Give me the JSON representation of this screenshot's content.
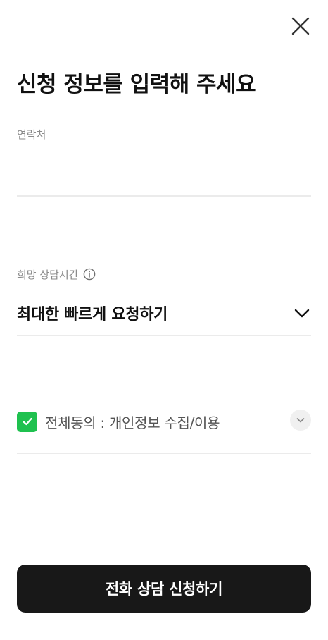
{
  "header": {
    "close_icon": "close-icon",
    "title": "신청 정보를 입력해 주세요"
  },
  "contact": {
    "label": "연락처",
    "value": "",
    "placeholder": ""
  },
  "consult_time": {
    "label": "희망 상담시간",
    "info_icon": "info-icon",
    "selected": "최대한 빠르게 요청하기",
    "chevron_icon": "chevron-down-icon"
  },
  "agreement": {
    "checked": true,
    "label": "전체동의 : 개인정보 수집/이용",
    "expand_icon": "chevron-down-icon"
  },
  "submit": {
    "label": "전화 상담 신청하기"
  },
  "colors": {
    "accent_green": "#1fc14f",
    "button_bg": "#181818",
    "label_gray": "#8a8a8a",
    "divider": "#ebebeb"
  }
}
